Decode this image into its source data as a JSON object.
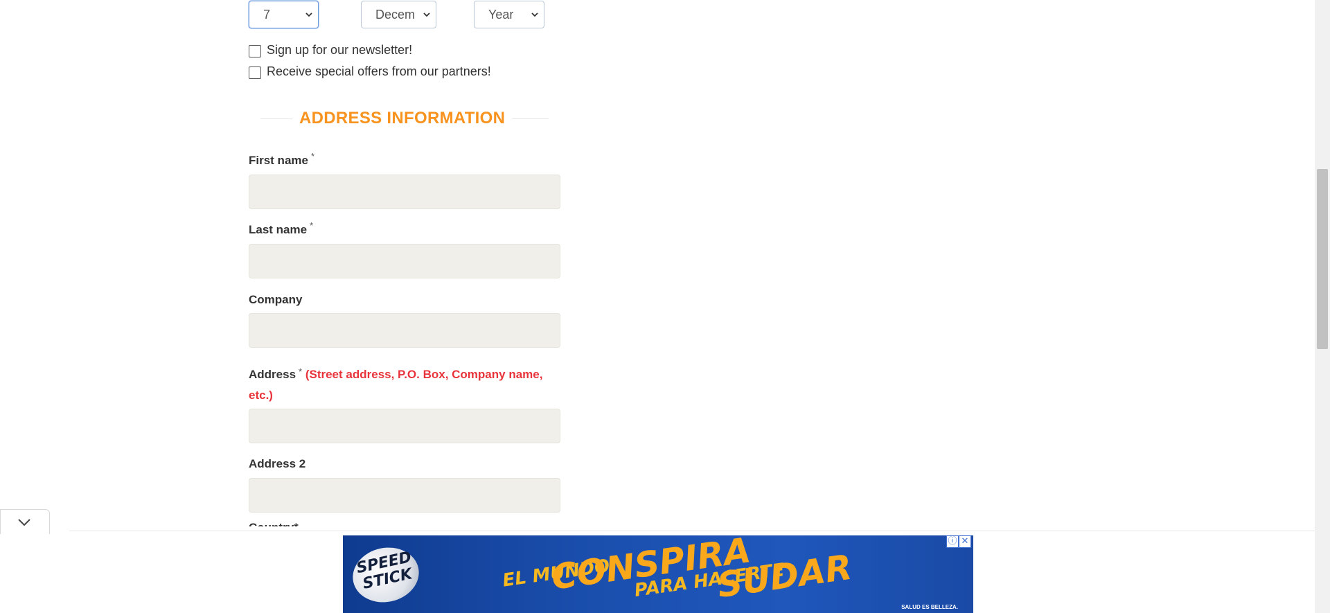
{
  "dob": {
    "day": "7",
    "month": "Decem",
    "year": "Year"
  },
  "checkboxes": {
    "newsletter": "Sign up for our newsletter!",
    "offers": "Receive special offers from our partners!"
  },
  "address_section": {
    "title": "ADDRESS INFORMATION",
    "required_mark": "*",
    "fields": {
      "first_name": "First name",
      "last_name": "Last name",
      "company": "Company",
      "address": "Address",
      "address_hint": "(Street address, P.O. Box, Company name,",
      "address_hint_2": "etc.)",
      "address2": "Address 2",
      "country": "Country"
    }
  },
  "ad": {
    "brand": "SPEED STICK",
    "line1": "EL MUNDO",
    "line2": "CONSPIRA",
    "line3": "PARA HACERTE",
    "line4": "SUDAR",
    "tagline": "SALUD ES BELLEZA.",
    "info_icon": "info-icon",
    "close_icon": "close-icon"
  }
}
